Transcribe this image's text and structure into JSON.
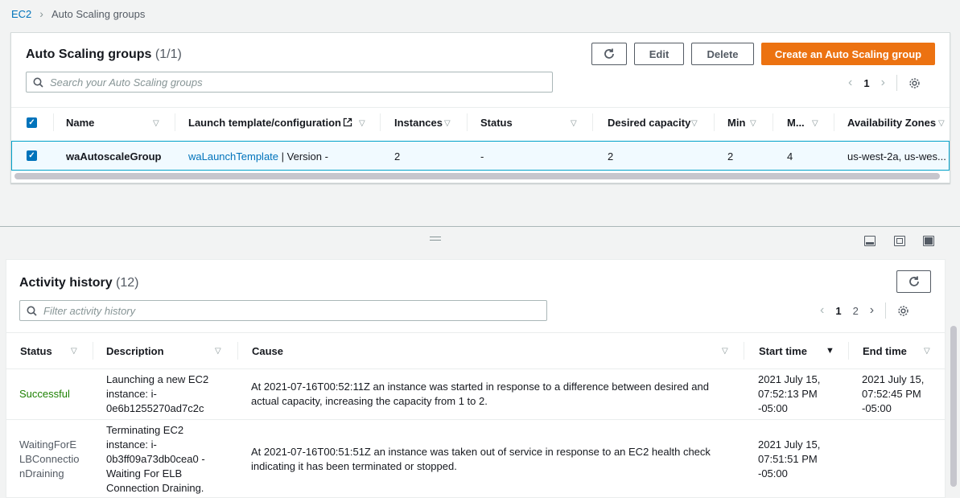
{
  "breadcrumb": {
    "root": "EC2",
    "current": "Auto Scaling groups"
  },
  "asg": {
    "title": "Auto Scaling groups",
    "count": "(1/1)",
    "buttons": {
      "edit": "Edit",
      "delete": "Delete",
      "create": "Create an Auto Scaling group"
    },
    "search_placeholder": "Search your Auto Scaling groups",
    "page": "1",
    "columns": [
      "Name",
      "Launch template/configuration",
      "Instances",
      "Status",
      "Desired capacity",
      "Min",
      "M...",
      "Availability Zones"
    ],
    "row": {
      "name": "waAutoscaleGroup",
      "template": "waLaunchTemplate",
      "version": " | Version -",
      "instances": "2",
      "status": "-",
      "desired": "2",
      "min": "2",
      "max": "4",
      "zones": "us-west-2a, us-wes..."
    }
  },
  "activity": {
    "title": "Activity history",
    "count": "(12)",
    "search_placeholder": "Filter activity history",
    "pages": [
      "1",
      "2"
    ],
    "columns": [
      "Status",
      "Description",
      "Cause",
      "Start time",
      "End time"
    ],
    "rows": [
      {
        "status_lines": [
          "Successful"
        ],
        "desc_lines": [
          "Launching a new EC2",
          "instance: i-",
          "0e6b1255270ad7c2c"
        ],
        "cause_lines": [
          "At 2021-07-16T00:52:11Z an instance was started in response to a difference between desired and",
          "actual capacity, increasing the capacity from 1 to 2."
        ],
        "start_lines": [
          "2021 July 15,",
          "07:52:13 PM",
          "-05:00"
        ],
        "end_lines": [
          "2021 July 15,",
          "07:52:45 PM",
          "-05:00"
        ]
      },
      {
        "status_lines": [
          "WaitingForE",
          "LBConnectio",
          "nDraining"
        ],
        "desc_lines": [
          "Terminating EC2",
          "instance: i-",
          "0b3ff09a73db0cea0 -",
          "Waiting For ELB",
          "Connection Draining."
        ],
        "cause_lines": [
          "At 2021-07-16T00:51:51Z an instance was taken out of service in response to an EC2 health check",
          "indicating it has been terminated or stopped."
        ],
        "start_lines": [
          "2021 July 15,",
          "07:51:51 PM",
          "-05:00"
        ],
        "end_lines": []
      }
    ]
  },
  "colors": {
    "accent": "#ec7211",
    "link": "#0073bb",
    "success": "#1d8102"
  }
}
